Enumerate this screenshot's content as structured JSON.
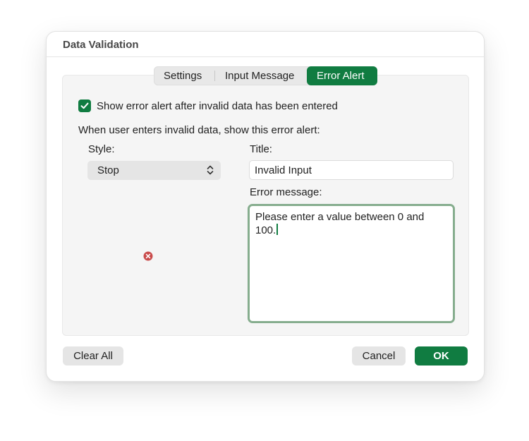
{
  "dialog": {
    "title": "Data Validation"
  },
  "tabs": [
    {
      "label": "Settings"
    },
    {
      "label": "Input Message"
    },
    {
      "label": "Error Alert"
    }
  ],
  "active_tab": "Error Alert",
  "show_error_alert": {
    "checked": true,
    "label": "Show error alert after invalid data has been entered"
  },
  "intro_text": "When user enters invalid data, show this error alert:",
  "style": {
    "label": "Style:",
    "selected": "Stop",
    "icon": "stop-error-icon"
  },
  "title_field": {
    "label": "Title:",
    "value": "Invalid Input"
  },
  "error_message": {
    "label": "Error message:",
    "value": "Please enter a value between 0 and 100."
  },
  "buttons": {
    "clear_all": "Clear All",
    "cancel": "Cancel",
    "ok": "OK"
  },
  "colors": {
    "accent": "#107c41",
    "focus_ring": "#86ad8e",
    "stop_icon": "#c94c4c"
  }
}
